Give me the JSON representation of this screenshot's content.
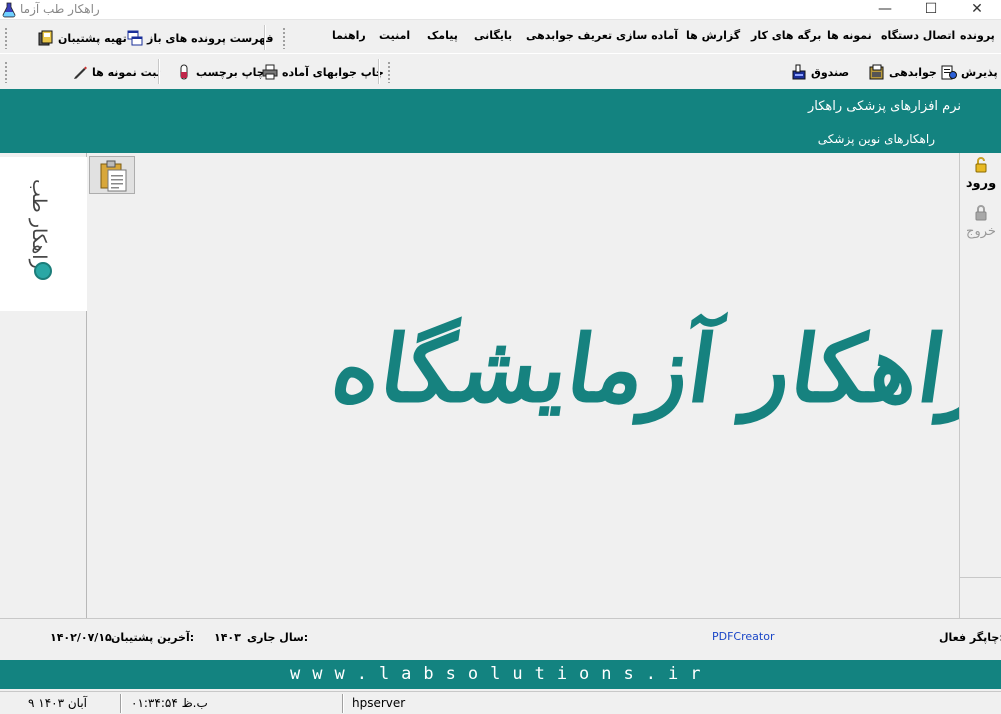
{
  "window": {
    "title": "راهکار طب آزما",
    "controls": {
      "minimize": "—",
      "maximize": "☐",
      "close": "✕"
    }
  },
  "menu": {
    "items": [
      "پرونده",
      "اتصال دستگاه",
      "نمونه ها",
      "برگه های کار",
      "گزارش ها",
      "آماده سازی",
      "تعریف جوابدهی",
      "بایگانی",
      "پیامک",
      "امنیت",
      "راهنما"
    ],
    "left_buttons": [
      {
        "label": "فهرست پرونده های باز",
        "icon": "window-list-icon"
      },
      {
        "label": "تهیه پشتیبان",
        "icon": "backup-icon"
      }
    ]
  },
  "toolbar": {
    "right_buttons": [
      {
        "label": "پذیرش",
        "icon": "reception-icon"
      },
      {
        "label": "جوابدهی",
        "icon": "results-icon"
      },
      {
        "label": "صندوق",
        "icon": "cashbox-icon"
      }
    ],
    "left_buttons": [
      {
        "label": "چاپ جوابهای آماده",
        "icon": "printer-icon"
      },
      {
        "label": "چاپ برچسب",
        "icon": "tube-label-icon"
      },
      {
        "label": "ثبت نمونه ها",
        "icon": "pen-icon"
      }
    ]
  },
  "header": {
    "line1": "نرم افزارهای پزشکی راهکار",
    "line2": "راهکارهای نوین پزشکی"
  },
  "side": {
    "login": "ورود",
    "logout": "خروج"
  },
  "logo": {
    "text": "راهکار طب"
  },
  "main": {
    "title": "راهکار آزمایشگاه"
  },
  "info": {
    "active_printer_label": "چاپگر فعال:",
    "active_printer_value": "PDFCreator",
    "current_year_label": "سال جاری:",
    "current_year_value": "۱۴۰۳",
    "last_backup_label": "آخرین پشتیبان:",
    "last_backup_value": "۱۴۰۲/۰۷/۱۵"
  },
  "footer": {
    "url": "www.labsolutions.ir"
  },
  "status": {
    "date": "۹ آبان ۱۴۰۳",
    "time": "۰۱:۳۴:۵۴ ب.ظ",
    "server": "hpserver"
  },
  "colors": {
    "teal": "#138380",
    "title_teal": "#16827f",
    "link": "#1a46c7"
  }
}
